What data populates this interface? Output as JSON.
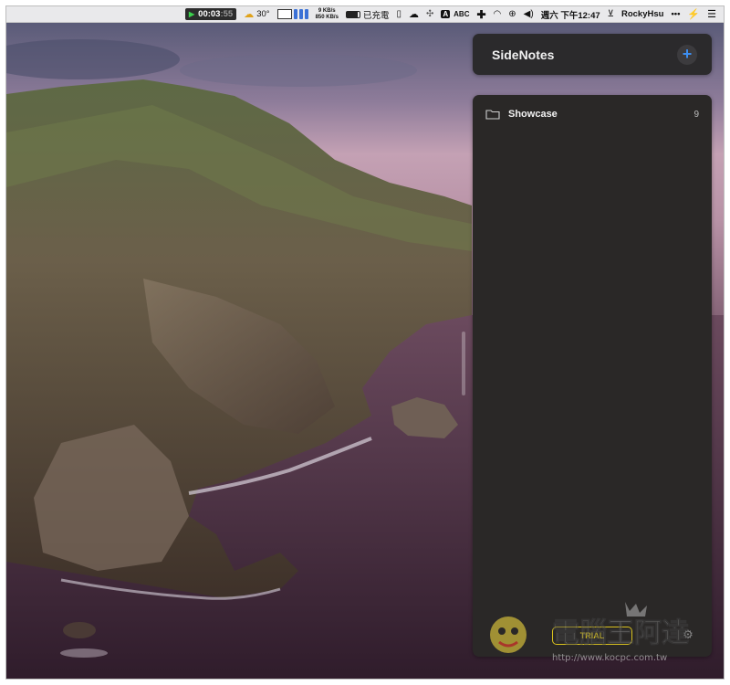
{
  "menubar": {
    "timer_main": "00:03",
    "timer_sec": ":55",
    "weather": "30°",
    "net_up": "9 KB/s",
    "net_down": "850 KB/s",
    "charging": "已充電",
    "ime": "A",
    "ime_label": "ABC",
    "datetime": "週六 下午12:47",
    "user": "RockyHsu",
    "more": "•••"
  },
  "sidenotes": {
    "title": "SideNotes",
    "add_symbol": "+",
    "folders": [
      {
        "name": "Showcase",
        "count": "9"
      }
    ],
    "trial_label": "TRIAL",
    "settings_symbol": "⚙"
  },
  "watermark": {
    "title": "電腦王阿達",
    "url": "http://www.kocpc.com.tw"
  }
}
